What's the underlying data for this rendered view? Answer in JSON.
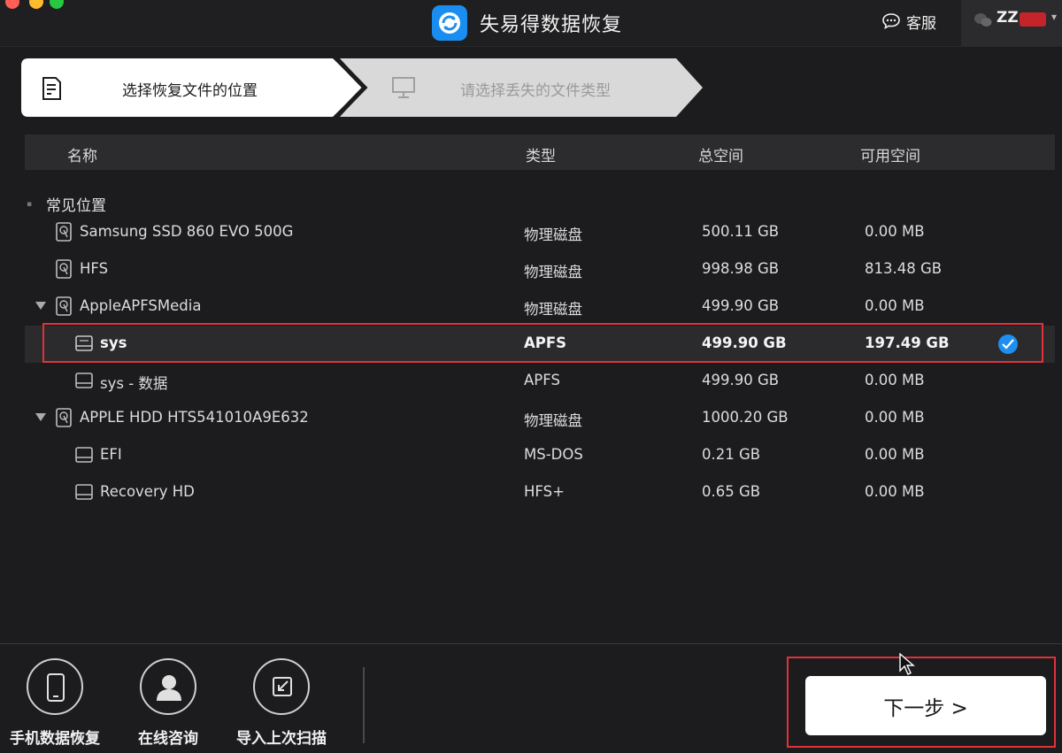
{
  "app": {
    "title": "失易得数据恢复",
    "support_label": "客服",
    "user_name": "ZZ"
  },
  "steps": [
    {
      "label": "选择恢复文件的位置",
      "active": true
    },
    {
      "label": "请选择丢失的文件类型",
      "active": false
    }
  ],
  "table": {
    "columns": {
      "name": "名称",
      "type": "类型",
      "total": "总空间",
      "free": "可用空间"
    },
    "section": "常见位置",
    "rows": [
      {
        "name": "Samsung SSD 860 EVO 500G",
        "type": "物理磁盘",
        "total": "500.11 GB",
        "free": "0.00 MB",
        "icon": "hard-disk-icon"
      },
      {
        "name": "HFS",
        "type": "物理磁盘",
        "total": "998.98 GB",
        "free": "813.48 GB",
        "icon": "hard-disk-icon"
      },
      {
        "name": "AppleAPFSMedia",
        "type": "物理磁盘",
        "total": "499.90 GB",
        "free": "0.00 MB",
        "icon": "hard-disk-icon"
      },
      {
        "name": "sys",
        "type": "APFS",
        "total": "499.90 GB",
        "free": "197.49 GB",
        "icon": "volume-icon",
        "selected": true
      },
      {
        "name": "sys - 数据",
        "type": "APFS",
        "total": "499.90 GB",
        "free": "0.00 MB",
        "icon": "volume-icon"
      },
      {
        "name": "APPLE HDD HTS541010A9E632",
        "type": "物理磁盘",
        "total": "1000.20 GB",
        "free": "0.00 MB",
        "icon": "hard-disk-icon"
      },
      {
        "name": "EFI",
        "type": "MS-DOS",
        "total": "0.21 GB",
        "free": "0.00 MB",
        "icon": "volume-icon"
      },
      {
        "name": "Recovery HD",
        "type": "HFS+",
        "total": "0.65 GB",
        "free": "0.00 MB",
        "icon": "volume-icon"
      }
    ]
  },
  "bottom": {
    "tools": [
      {
        "label": "手机数据恢复",
        "icon": "phone-icon"
      },
      {
        "label": "在线咨询",
        "icon": "person-icon"
      },
      {
        "label": "导入上次扫描",
        "icon": "import-icon"
      }
    ],
    "next_label": "下一步 >"
  },
  "colors": {
    "background": "#1c1c1e",
    "accent": "#1e8ef0",
    "highlight_frame": "#e0323a"
  }
}
